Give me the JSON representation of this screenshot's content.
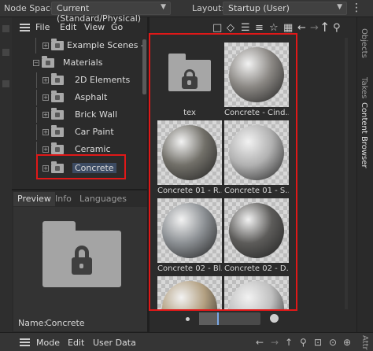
{
  "top": {
    "node_space_label": "Node Space:",
    "node_space_value": "Current (Standard/Physical)",
    "layout_label": "Layout:",
    "layout_value": "Startup (User)"
  },
  "menu": {
    "file": "File",
    "edit": "Edit",
    "view": "View",
    "go": "Go"
  },
  "tree": [
    {
      "label": "Example Scenes - Fea",
      "level": 1,
      "expandable": true
    },
    {
      "label": "Materials",
      "level": 0,
      "expandable": true
    },
    {
      "label": "2D Elements",
      "level": 2,
      "expandable": true
    },
    {
      "label": "Asphalt",
      "level": 2,
      "expandable": true
    },
    {
      "label": "Brick Wall",
      "level": 2,
      "expandable": true
    },
    {
      "label": "Car Paint",
      "level": 2,
      "expandable": true
    },
    {
      "label": "Ceramic",
      "level": 2,
      "expandable": true
    },
    {
      "label": "Concrete",
      "level": 2,
      "expandable": true,
      "selected": true
    }
  ],
  "preview_tabs": [
    "Preview",
    "Info",
    "Languages"
  ],
  "preview": {
    "name_label": "Name:",
    "name_value": "Concrete"
  },
  "assets": [
    {
      "caption": "tex",
      "kind": "folder"
    },
    {
      "caption": "Concrete - Cind...",
      "kind": "material",
      "color": "#8a8783"
    },
    {
      "caption": "Concrete 01 - R...",
      "kind": "material",
      "color": "#727069"
    },
    {
      "caption": "Concrete 01 - S...",
      "kind": "material",
      "color": "#b1b1b1"
    },
    {
      "caption": "Concrete 02 - Bl...",
      "kind": "material",
      "color": "#8c9094"
    },
    {
      "caption": "Concrete 02 - D...",
      "kind": "material",
      "color": "#5d5c5a"
    },
    {
      "caption": "",
      "kind": "material",
      "color": "#b29f80"
    },
    {
      "caption": "",
      "kind": "material",
      "color": "#c0c0c0"
    }
  ],
  "side_tabs": [
    "Objects",
    "Takes",
    "Content Browser"
  ],
  "bottom": {
    "mode": "Mode",
    "edit": "Edit",
    "user_data": "User Data",
    "attr": "Attr"
  },
  "colors": {
    "highlight": "#e01818",
    "selection": "#3c4b63",
    "slider_knob": "#7aa8e6"
  },
  "zoom": {
    "level": 0.3
  }
}
